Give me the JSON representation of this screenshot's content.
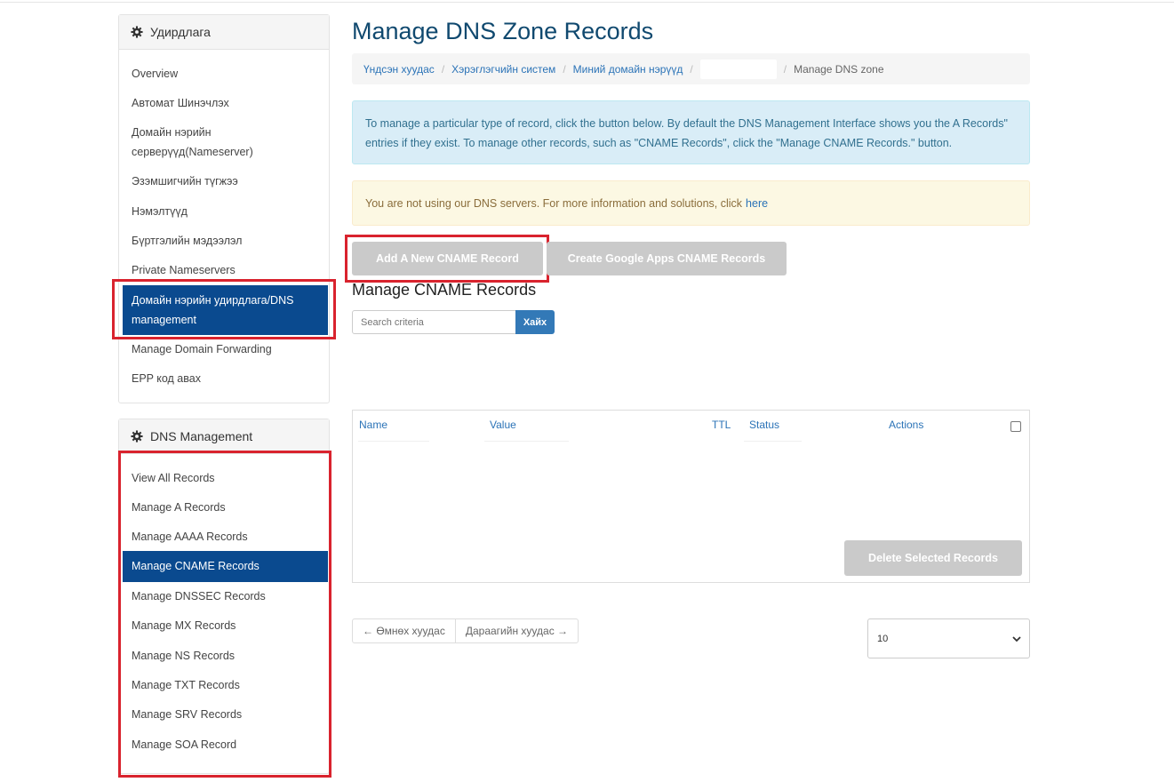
{
  "sidebar": {
    "panel1": {
      "title": "Удирдлага",
      "items": [
        {
          "label": "Overview"
        },
        {
          "label": "Автомат Шинэчлэх"
        },
        {
          "label": "Домайн нэрийн серверүүд(Nameserver)"
        },
        {
          "label": "Эзэмшигчийн түгжээ"
        },
        {
          "label": "Нэмэлтүүд"
        },
        {
          "label": "Бүртгэлийн мэдээлэл"
        },
        {
          "label": "Private Nameservers"
        },
        {
          "label": "Домайн нэрийн удирдлага/DNS management"
        },
        {
          "label": "Manage Domain Forwarding"
        },
        {
          "label": "EPP код авах"
        }
      ]
    },
    "panel2": {
      "title": "DNS Management",
      "items": [
        {
          "label": "View All Records"
        },
        {
          "label": "Manage A Records"
        },
        {
          "label": "Manage AAAA Records"
        },
        {
          "label": "Manage CNAME Records"
        },
        {
          "label": "Manage DNSSEC Records"
        },
        {
          "label": "Manage MX Records"
        },
        {
          "label": "Manage NS Records"
        },
        {
          "label": "Manage TXT Records"
        },
        {
          "label": "Manage SRV Records"
        },
        {
          "label": "Manage SOA Record"
        }
      ]
    }
  },
  "main": {
    "title": "Manage DNS Zone Records",
    "breadcrumb": [
      "Үндсэн хуудас",
      "Хэрэглэгчийн систем",
      "Миний домайн нэрүүд",
      "Manage DNS zone"
    ],
    "info_line1": "To manage a particular type of record, click the button below. By default the DNS Management Interface shows you the  A Records\"",
    "info_line2": "entries if they exist. To manage other records, such as \"CNAME Records\", click the \"Manage CNAME Records.\" button.",
    "warning_text": "You are not using our DNS servers. For more information and solutions, click",
    "warning_link": "here",
    "add_button": "Add A New CNAME Record",
    "google_button": "Create Google Apps CNAME Records",
    "subtitle": "Manage CNAME Records",
    "search_placeholder": "Search criteria",
    "search_button": "Хайх",
    "table_headers": [
      "Name",
      "Value",
      "TTL",
      "Status",
      "Actions"
    ],
    "delete_button": "Delete Selected Records",
    "prev_page": "← Өмнөх хуудас",
    "next_page": "Дараагийн хуудас →",
    "per_page": "10"
  },
  "colors": {
    "active_bg": "#0a4a8f",
    "title": "#10496f",
    "link": "#2b73b7",
    "highlight_border": "#d9232e",
    "disabled_button": "#cacaca"
  }
}
